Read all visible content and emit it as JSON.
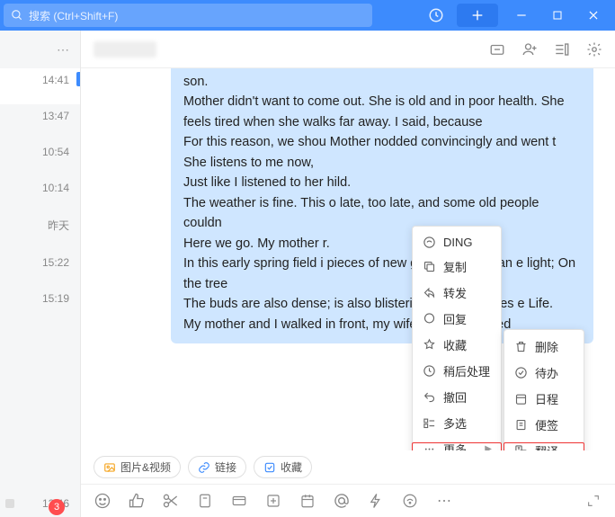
{
  "titlebar": {
    "search_placeholder": "搜索 (Ctrl+Shift+F)"
  },
  "sidebar": {
    "times": [
      "14:41",
      "13:47",
      "10:54",
      "10:14",
      "昨天",
      "15:22",
      "15:19"
    ],
    "footer_time": "12:46",
    "badge": "3"
  },
  "message": {
    "lines": [
      "son.",
      "Mother didn't want to come out. She is old and in poor health. She feels tired when she walks far away. I said, because",
      "For this reason, we shou                       Mother nodded convincingly and went t                        She listens to me now,",
      "Just like I listened to her                          hild.",
      "The weather is fine. This                        o late, too late, and some old people couldn",
      "Here we go. My mother                                             r.",
      "In this early spring field i                                         pieces of new green are laid ran                                       e light; On the tree",
      "The buds are also dense;                                           is also blistering. All this makes                                        e Life.",
      "My mother and I walked in front, my wife and son walked"
    ]
  },
  "context_menu": {
    "items": [
      {
        "icon": "ding",
        "label": "DING"
      },
      {
        "icon": "copy",
        "label": "复制"
      },
      {
        "icon": "forward",
        "label": "转发"
      },
      {
        "icon": "reply",
        "label": "回复"
      },
      {
        "icon": "fav",
        "label": "收藏"
      },
      {
        "icon": "later",
        "label": "稍后处理"
      },
      {
        "icon": "revoke",
        "label": "撤回"
      },
      {
        "icon": "multi",
        "label": "多选"
      },
      {
        "icon": "more",
        "label": "更多",
        "arrow": true
      }
    ],
    "sub_items": [
      {
        "icon": "delete",
        "label": "删除"
      },
      {
        "icon": "todo",
        "label": "待办"
      },
      {
        "icon": "calendar",
        "label": "日程"
      },
      {
        "icon": "note",
        "label": "便签"
      },
      {
        "icon": "translate",
        "label": "翻译"
      }
    ]
  },
  "attach": {
    "pic_video": "图片&视频",
    "link": "链接",
    "fav": "收藏"
  }
}
